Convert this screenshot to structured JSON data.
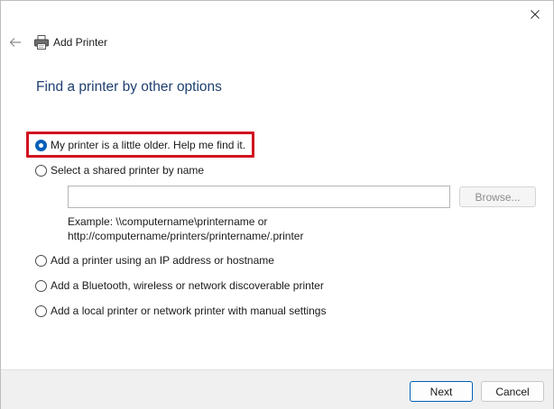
{
  "window": {
    "title": "Add Printer",
    "close_icon": "close-icon",
    "back_icon": "back-arrow-icon",
    "printer_icon": "printer-icon"
  },
  "heading": "Find a printer by other options",
  "options": [
    {
      "label": "My printer is a little older. Help me find it.",
      "checked": true
    },
    {
      "label": "Select a shared printer by name",
      "checked": false
    },
    {
      "label": "Add a printer using an IP address or hostname",
      "checked": false
    },
    {
      "label": "Add a Bluetooth, wireless or network discoverable printer",
      "checked": false
    },
    {
      "label": "Add a local printer or network printer with manual settings",
      "checked": false
    }
  ],
  "shared_printer": {
    "input_value": "",
    "browse_label": "Browse...",
    "example_line1": "Example: \\\\computername\\printername or",
    "example_line2": "http://computername/printers/printername/.printer"
  },
  "footer": {
    "next_label": "Next",
    "cancel_label": "Cancel"
  },
  "colors": {
    "heading": "#1e3f6f",
    "accent": "#005fb8",
    "highlight_border": "#d1121f"
  }
}
